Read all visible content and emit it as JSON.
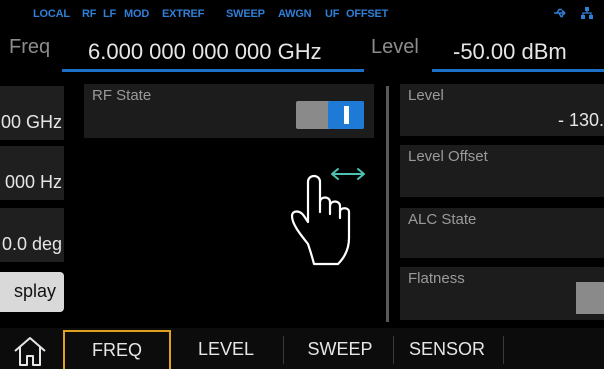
{
  "status_bar": {
    "items": [
      "LOCAL",
      "RF",
      "LF",
      "MOD",
      "EXTREF",
      "SWEEP",
      "AWGN",
      "UF",
      "OFFSET"
    ],
    "icons": [
      "usb-icon",
      "network-icon"
    ],
    "color": "#2f7fd6"
  },
  "header": {
    "freq_label": "Freq",
    "freq_value": "6.000 000 000 000  GHz",
    "level_label": "Level",
    "level_value": "-50.00  dBm"
  },
  "left_column": {
    "tiles": [
      "00 GHz",
      "000 Hz",
      "0.0 deg"
    ],
    "display_button": "splay"
  },
  "center": {
    "rf_state_title": "RF State",
    "rf_state_on": true
  },
  "right_column": {
    "level_title": "Level",
    "level_value": "- 130.",
    "level_offset_title": "Level Offset",
    "alc_state_title": "ALC State",
    "flatness_title": "Flatness"
  },
  "tabs": {
    "items": [
      "FREQ",
      "LEVEL",
      "SWEEP",
      "SENSOR"
    ],
    "active": "FREQ"
  },
  "colors": {
    "accent_blue": "#1f7ad6",
    "active_tab_border": "#e0a020",
    "gesture_arrow": "#4fc1b0"
  },
  "gesture_icon": "swipe-horizontal-hand-icon"
}
